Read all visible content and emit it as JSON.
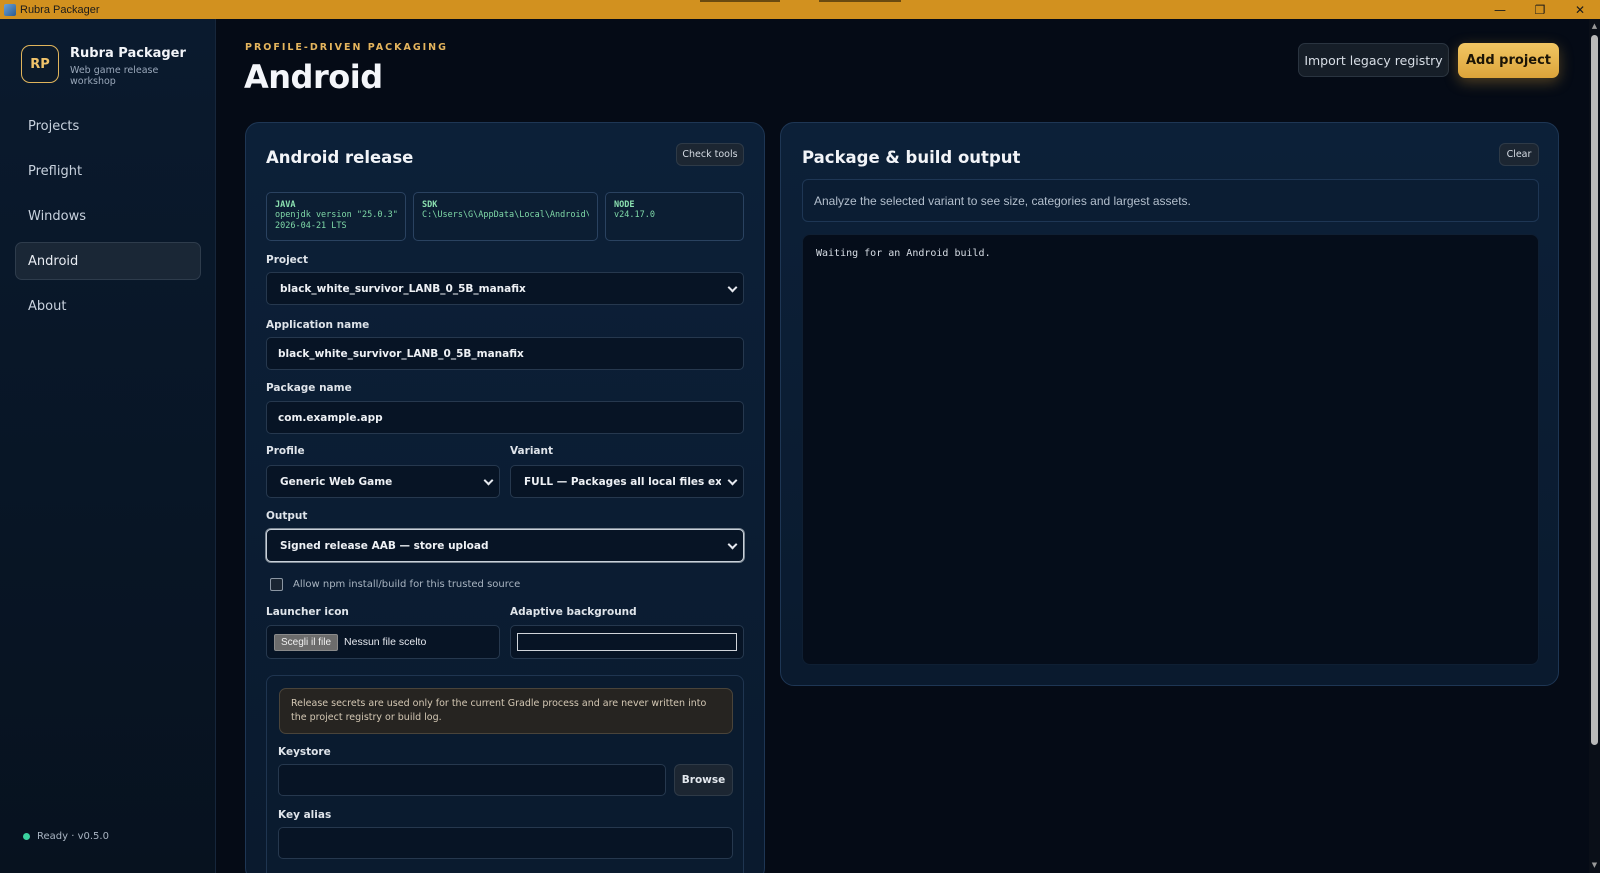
{
  "window": {
    "title": "Rubra Packager",
    "controls": {
      "minimize": "—",
      "restore": "❐",
      "close": "✕"
    }
  },
  "sidebar": {
    "brand": {
      "logo": "RP",
      "name": "Rubra Packager",
      "subtitle": "Web game release workshop"
    },
    "items": [
      {
        "label": "Projects",
        "active": false
      },
      {
        "label": "Preflight",
        "active": false
      },
      {
        "label": "Windows",
        "active": false
      },
      {
        "label": "Android",
        "active": true
      },
      {
        "label": "About",
        "active": false
      }
    ],
    "status": "Ready · v0.5.0"
  },
  "header": {
    "eyebrow": "PROFILE-DRIVEN PACKAGING",
    "title": "Android",
    "import_label": "Import legacy registry",
    "add_label": "Add project"
  },
  "release": {
    "title": "Android release",
    "check_tools_label": "Check tools",
    "tools": [
      {
        "label": "JAVA",
        "lines": [
          "openjdk version \"25.0.3\"",
          "2026-04-21 LTS"
        ]
      },
      {
        "label": "SDK",
        "lines": [
          "C:\\Users\\G\\AppData\\Local\\Android\\Sdk"
        ]
      },
      {
        "label": "NODE",
        "lines": [
          "v24.17.0"
        ]
      }
    ],
    "project_label": "Project",
    "project_value": "black_white_survivor_LANB_0_5B_manafix",
    "app_name_label": "Application name",
    "app_name_value": "black_white_survivor_LANB_0_5B_manafix",
    "package_label": "Package name",
    "package_value": "com.example.app",
    "profile_label": "Profile",
    "profile_value": "Generic Web Game",
    "variant_label": "Variant",
    "variant_value": "FULL — Packages all local files except deve",
    "output_label": "Output",
    "output_value": "Signed release AAB — store upload",
    "npm_label": "Allow npm install/build for this trusted source",
    "launcher_label": "Launcher icon",
    "file_button": "Scegli il file",
    "file_status": "Nessun file scelto",
    "adaptive_label": "Adaptive background",
    "secrets_notice": "Release secrets are used only for the current Gradle process and are never written into the project registry or build log.",
    "keystore_label": "Keystore",
    "keystore_value": "",
    "browse_label": "Browse",
    "alias_label": "Key alias",
    "alias_value": ""
  },
  "output_panel": {
    "title": "Package & build output",
    "clear_label": "Clear",
    "hint": "Analyze the selected variant to see size, categories and largest assets.",
    "log": "Waiting for an Android build."
  }
}
